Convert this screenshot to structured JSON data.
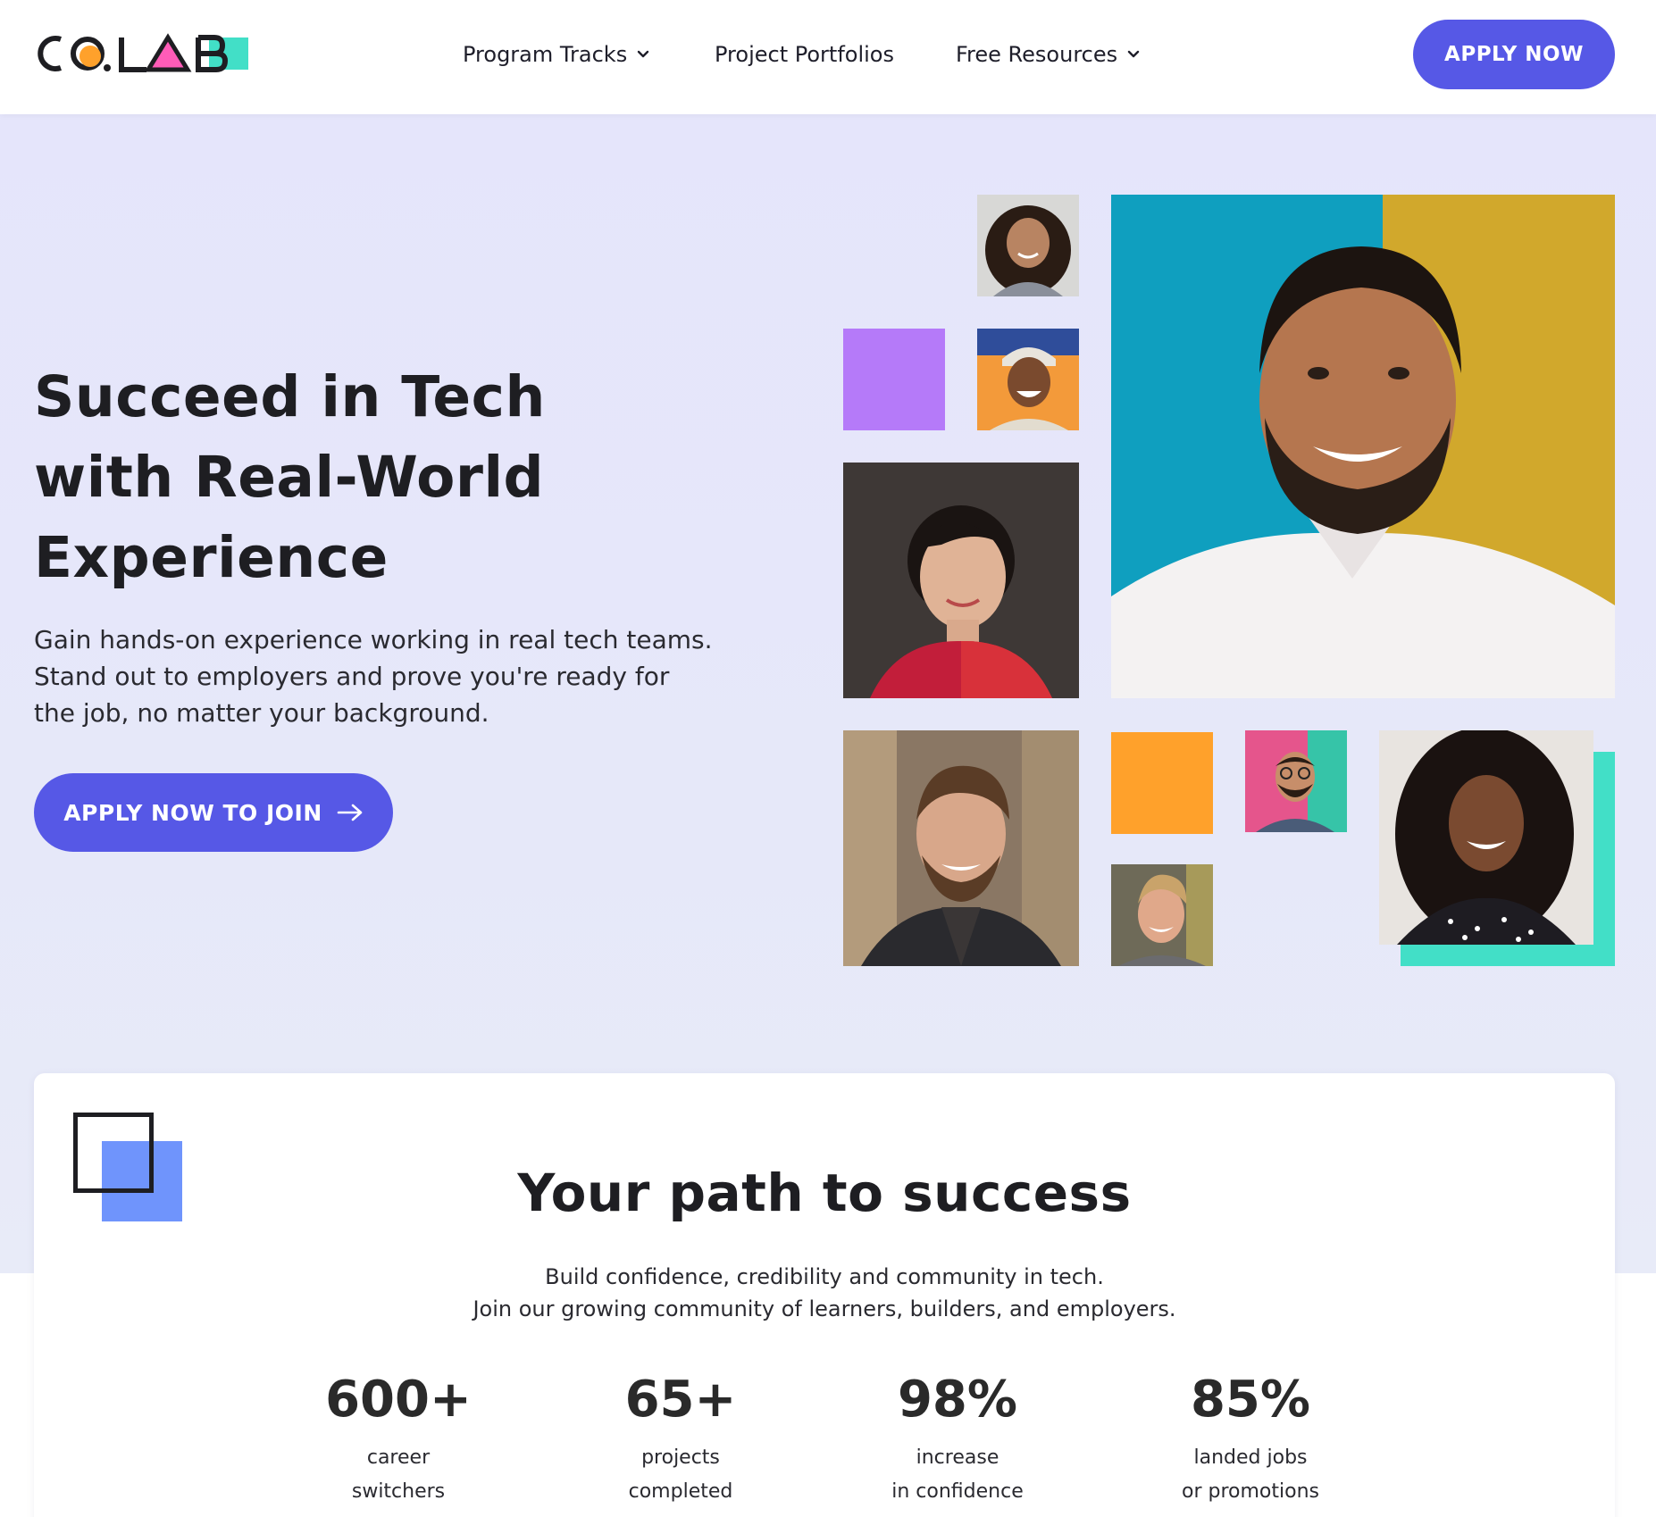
{
  "brand": {
    "logo_text": "CO.LAB",
    "colors": {
      "primary": "#5658e6",
      "purple": "#b57af9",
      "orange": "#ffa12b",
      "teal": "#42dfc7",
      "blue": "#6f94fc",
      "hero_bg": "#e5e5fb"
    }
  },
  "nav": {
    "items": [
      {
        "label": "Program Tracks",
        "has_dropdown": true,
        "icon": "chevron-down-icon"
      },
      {
        "label": "Project Portfolios",
        "has_dropdown": false
      },
      {
        "label": "Free Resources",
        "has_dropdown": true,
        "icon": "chevron-down-icon"
      }
    ],
    "cta_label": "APPLY NOW"
  },
  "hero": {
    "title": "Succeed in Tech\nwith Real-World\nExperience",
    "subtitle": "Gain hands-on experience working in real tech teams. Stand out to employers and prove you're ready for the job, no matter your background.",
    "cta_label": "APPLY NOW TO JOIN",
    "cta_icon": "arrow-right-icon"
  },
  "stats_section": {
    "title": "Your path to success",
    "subtitle_line1": "Build confidence, credibility and community in tech.",
    "subtitle_line2": "Join our growing community of learners, builders, and employers.",
    "stats": [
      {
        "value": "600+",
        "label": "career\nswitchers"
      },
      {
        "value": "65+",
        "label": "projects\ncompleted"
      },
      {
        "value": "98%",
        "label": "increase\nin confidence"
      },
      {
        "value": "85%",
        "label": "landed jobs\nor promotions"
      }
    ]
  }
}
